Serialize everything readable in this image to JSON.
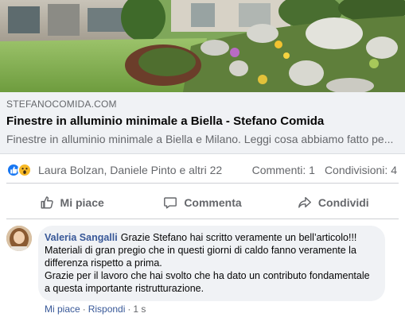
{
  "preview": {
    "domain": "STEFANOCOMIDA.COM",
    "title": "Finestre in alluminio minimale a Biella - Stefano Comida",
    "description": "Finestre in alluminio minimale a Biella e Milano. Leggi cosa abbiamo fatto pe..."
  },
  "reactions": {
    "icons": [
      "like-icon",
      "wow-icon"
    ],
    "people": "Laura Bolzan, Daniele Pinto e altri 22",
    "comments": "Commenti: 1",
    "shares": "Condivisioni: 4"
  },
  "actions": {
    "like": "Mi piace",
    "comment": "Commenta",
    "share": "Condividi"
  },
  "comment": {
    "author": "Valeria Sangalli",
    "lines": [
      "Grazie Stefano hai scritto veramente un bell’articolo!!!",
      "Materiali di gran pregio che in questi giorni di caldo fanno veramente la differenza rispetto a prima.",
      "Grazie per il lavoro che hai svolto che ha dato un contributo fondamentale a questa importante ristrutturazione."
    ],
    "meta": {
      "like": "Mi piace",
      "reply": "Rispondi",
      "time": "1 s",
      "separator": "·"
    }
  },
  "colors": {
    "link_blue": "#385898",
    "like_blue": "#1877f2",
    "wow_yellow": "#f7b928",
    "secondary_text": "#65676b",
    "preview_bg": "#f0f2f5"
  }
}
